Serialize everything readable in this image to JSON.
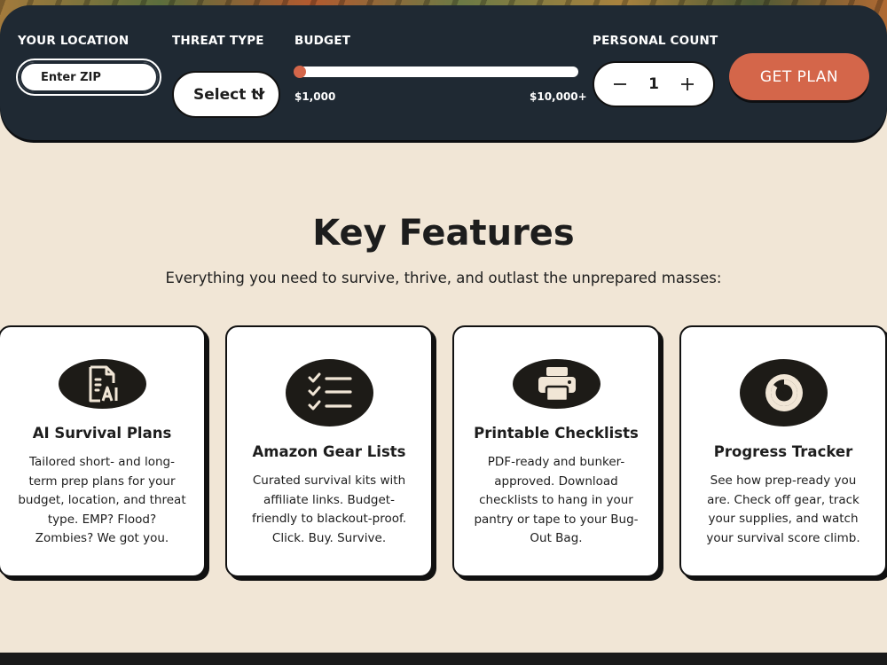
{
  "header": {
    "location": {
      "label": "YOUR LOCATION",
      "placeholder": "Enter ZIP"
    },
    "threat": {
      "label": "THREAT TYPE",
      "value": "Select th"
    },
    "budget": {
      "label": "BUDGET",
      "min_label": "$1,000",
      "max_label": "$10,000+",
      "min": 1000,
      "max": 10000,
      "value": 1000
    },
    "count": {
      "label": "PERSONAL COUNT",
      "value": "1",
      "minus": "−",
      "plus": "+"
    },
    "cta_label": "GET PLAN"
  },
  "features": {
    "title": "Key Features",
    "subtitle": "Everything you need to survive, thrive, and outlast the unprepared masses:",
    "cards": [
      {
        "icon": "ai-document-icon",
        "title": "AI Survival Plans",
        "description": "Tailored short- and long-term prep plans for your budget, location, and threat type. EMP? Flood? Zombies? We got you."
      },
      {
        "icon": "checklist-icon",
        "title": "Amazon Gear Lists",
        "description": "Curated survival kits with affiliate links. Budget-friendly to blackout-proof. Click. Buy. Survive."
      },
      {
        "icon": "printer-icon",
        "title": "Printable Checklists",
        "description": "PDF-ready and bunker-approved. Download checklists to hang in your pantry or tape to your Bug-Out Bag."
      },
      {
        "icon": "progress-ring-icon",
        "title": "Progress Tracker",
        "description": "See how prep-ready you are. Check off gear, track your supplies, and watch your survival score climb."
      }
    ]
  },
  "colors": {
    "panel": "#1f2933",
    "accent": "#d4664a",
    "background": "#f1e6d6",
    "ink": "#1d1b17"
  }
}
